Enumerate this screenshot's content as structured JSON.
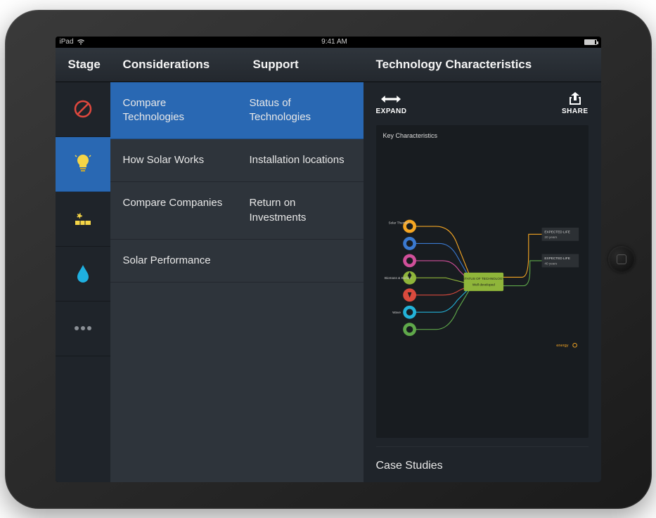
{
  "status": {
    "device": "iPad",
    "time": "9:41 AM"
  },
  "header": {
    "stage": "Stage",
    "considerations": "Considerations",
    "support": "Support",
    "tech": "Technology Characteristics"
  },
  "stage_icons": [
    {
      "name": "no-entry-icon",
      "color": "#e0483e",
      "selected": false
    },
    {
      "name": "lightbulb-icon",
      "color": "#f5d547",
      "selected": true
    },
    {
      "name": "solar-panel-icon",
      "color": "#f5d547",
      "selected": false
    },
    {
      "name": "water-drop-icon",
      "color": "#1fb0e0",
      "selected": false
    },
    {
      "name": "more-icon",
      "color": "#8a8f95",
      "selected": false
    }
  ],
  "menu": [
    {
      "considerations": "Compare Technologies",
      "support": "Status of Technologies",
      "selected": true
    },
    {
      "considerations": "How Solar Works",
      "support": "Installation locations",
      "selected": false
    },
    {
      "considerations": "Compare Companies",
      "support": "Return on Investments",
      "selected": false
    },
    {
      "considerations": "Solar Performance",
      "support": "",
      "selected": false
    }
  ],
  "actions": {
    "expand": "EXPAND",
    "share": "SHARE"
  },
  "infographic": {
    "title": "Key Characteristics",
    "center_label": "STATUS OF TECHNOLOGY",
    "center_sub": "Well developed",
    "nodes": [
      {
        "label": "Solar Thermal",
        "color": "#f5a623"
      },
      {
        "label": "",
        "color": "#3a79d0"
      },
      {
        "label": "",
        "color": "#d04f9a"
      },
      {
        "label": "Biomass & Biofuel",
        "color": "#8fb53a"
      },
      {
        "label": "",
        "color": "#d94a3d"
      },
      {
        "label": "Wave",
        "color": "#23b2d8"
      },
      {
        "label": "",
        "color": "#5fa84a"
      }
    ],
    "callouts": [
      {
        "title": "EXPECTED LIFE",
        "value": "20 years"
      },
      {
        "title": "EXPECTED LIFE",
        "value": "40 years"
      }
    ],
    "brand": "energy"
  },
  "case_studies": "Case Studies"
}
